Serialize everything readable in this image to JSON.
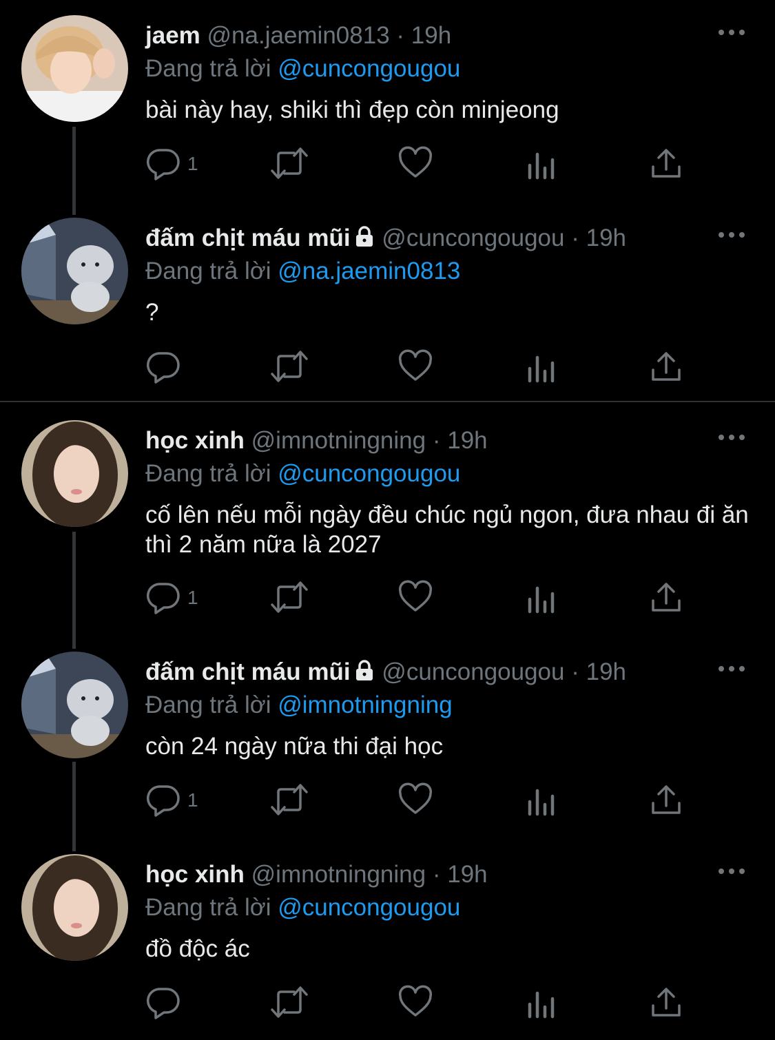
{
  "tweets": [
    {
      "name": "jaem",
      "handle": "@na.jaemin0813",
      "dot": "·",
      "time": "19h",
      "reply_prefix": "Đang trả lời",
      "reply_to": "@cuncongougou",
      "text": "bài này hay, shiki thì đẹp còn minjeong",
      "reply_count": "1",
      "locked": false
    },
    {
      "name": "đấm chịt máu mũi",
      "handle": "@cuncongougou",
      "dot": "·",
      "time": "19h",
      "reply_prefix": "Đang trả lời",
      "reply_to": "@na.jaemin0813",
      "text": "?",
      "reply_count": "",
      "locked": true
    },
    {
      "name": "học xinh",
      "handle": "@imnotningning",
      "dot": "·",
      "time": "19h",
      "reply_prefix": "Đang trả lời",
      "reply_to": "@cuncongougou",
      "text": "cố lên nếu mỗi ngày đều chúc ngủ ngon, đưa nhau đi ăn thì 2 năm nữa là 2027",
      "reply_count": "1",
      "locked": false
    },
    {
      "name": "đấm chịt máu mũi",
      "handle": "@cuncongougou",
      "dot": "·",
      "time": "19h",
      "reply_prefix": "Đang trả lời",
      "reply_to": "@imnotningning",
      "text": "còn 24 ngày nữa thi đại học",
      "reply_count": "1",
      "locked": true
    },
    {
      "name": "học xinh",
      "handle": "@imnotningning",
      "dot": "·",
      "time": "19h",
      "reply_prefix": "Đang trả lời",
      "reply_to": "@cuncongougou",
      "text": "đồ độc ác",
      "reply_count": "",
      "locked": false
    }
  ],
  "icons": {
    "reply": "reply-icon",
    "retweet": "retweet-icon",
    "like": "heart-icon",
    "views": "views-icon",
    "share": "share-icon",
    "more": "more-icon",
    "lock": "lock-icon"
  },
  "colors": {
    "background": "#000000",
    "text": "#e7e9ea",
    "muted": "#6e767d",
    "mention": "#1d9bf0",
    "icon": "#71767b",
    "thread_line": "#333639"
  }
}
